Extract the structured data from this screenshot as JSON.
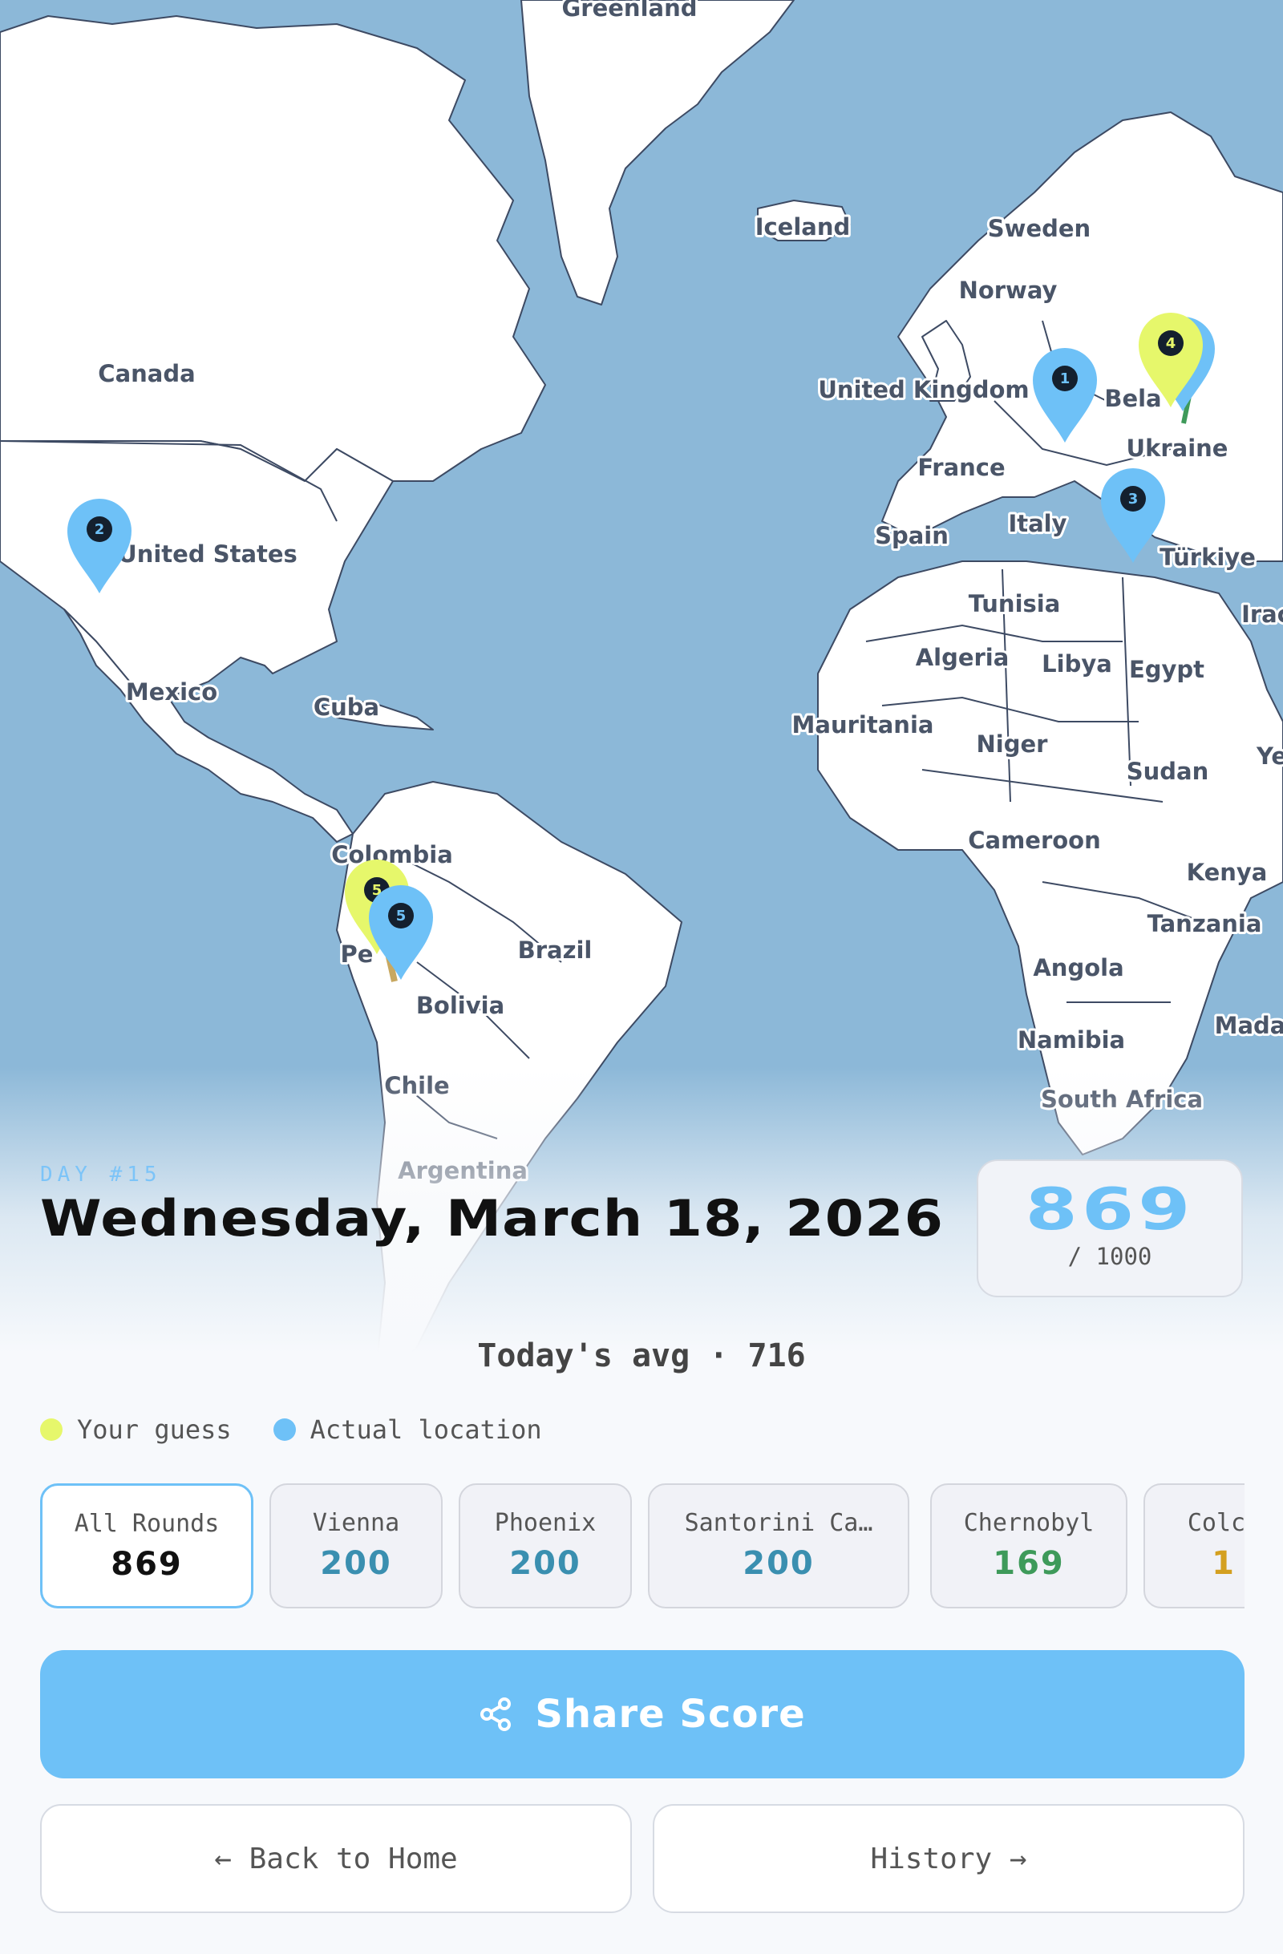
{
  "map": {
    "labels": [
      {
        "id": "greenland",
        "text": "Greenland"
      },
      {
        "id": "iceland",
        "text": "Iceland"
      },
      {
        "id": "sweden",
        "text": "Sweden"
      },
      {
        "id": "norway",
        "text": "Norway"
      },
      {
        "id": "canada",
        "text": "Canada"
      },
      {
        "id": "united-kingdom",
        "text": "United Kingdom"
      },
      {
        "id": "belarus",
        "text": "Bela"
      },
      {
        "id": "ukraine",
        "text": "Ukraine"
      },
      {
        "id": "france",
        "text": "France"
      },
      {
        "id": "italy",
        "text": "Italy"
      },
      {
        "id": "spain",
        "text": "Spain"
      },
      {
        "id": "turkiye",
        "text": "Türkiye"
      },
      {
        "id": "united-states",
        "text": "United States"
      },
      {
        "id": "tunisia",
        "text": "Tunisia"
      },
      {
        "id": "iraq",
        "text": "Irac"
      },
      {
        "id": "algeria",
        "text": "Algeria"
      },
      {
        "id": "libya",
        "text": "Libya"
      },
      {
        "id": "egypt",
        "text": "Egypt"
      },
      {
        "id": "mexico",
        "text": "Mexico"
      },
      {
        "id": "cuba",
        "text": "Cuba"
      },
      {
        "id": "mauritania",
        "text": "Mauritania"
      },
      {
        "id": "niger",
        "text": "Niger"
      },
      {
        "id": "sudan",
        "text": "Sudan"
      },
      {
        "id": "yemen",
        "text": "Ye"
      },
      {
        "id": "cameroon",
        "text": "Cameroon"
      },
      {
        "id": "colombia",
        "text": "Colombia"
      },
      {
        "id": "kenya",
        "text": "Kenya"
      },
      {
        "id": "tanzania",
        "text": "Tanzania"
      },
      {
        "id": "brazil",
        "text": "Brazil"
      },
      {
        "id": "peru",
        "text": "Pe"
      },
      {
        "id": "angola",
        "text": "Angola"
      },
      {
        "id": "bolivia",
        "text": "Bolivia"
      },
      {
        "id": "madagascar",
        "text": "Mada"
      },
      {
        "id": "namibia",
        "text": "Namibia"
      },
      {
        "id": "chile",
        "text": "Chile"
      },
      {
        "id": "south-africa",
        "text": "South Africa"
      },
      {
        "id": "argentina",
        "text": "Argentina"
      }
    ],
    "markers": [
      {
        "round": "1",
        "type": "actual"
      },
      {
        "round": "2",
        "type": "actual"
      },
      {
        "round": "3",
        "type": "actual"
      },
      {
        "round": "4",
        "type": "actual"
      },
      {
        "round": "4",
        "type": "guess"
      },
      {
        "round": "5",
        "type": "guess"
      },
      {
        "round": "5",
        "type": "actual"
      }
    ]
  },
  "header": {
    "day_label": "DAY #15",
    "date": "Wednesday, March 18, 2026"
  },
  "score": {
    "value": "869",
    "max": "/ 1000"
  },
  "average": "Today's avg · 716",
  "legend": {
    "guess": "Your guess",
    "actual": "Actual location"
  },
  "colors": {
    "guess": "#e6f76b",
    "actual": "#6ec1f7",
    "accent": "#6ec1f7"
  },
  "rounds": [
    {
      "label": "All Rounds",
      "value": "869",
      "color": "#111111"
    },
    {
      "label": "Vienna",
      "value": "200",
      "color": "#3a8fb0"
    },
    {
      "label": "Phoenix",
      "value": "200",
      "color": "#3a8fb0"
    },
    {
      "label": "Santorini Ca…",
      "value": "200",
      "color": "#3a8fb0"
    },
    {
      "label": "Chernobyl",
      "value": "169",
      "color": "#3e9a5a"
    },
    {
      "label": "Colca",
      "value": "1",
      "color": "#d4a020"
    }
  ],
  "buttons": {
    "share": "Share Score",
    "back": "← Back to Home",
    "history": "History →"
  }
}
